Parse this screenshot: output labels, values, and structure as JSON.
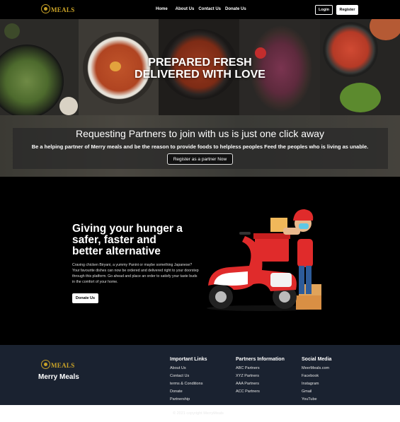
{
  "nav": {
    "logo_text": "MEALS",
    "links": [
      "Home",
      "About Us",
      "Contact Us",
      "Donate Us"
    ],
    "login_label": "Login",
    "register_label": "Register"
  },
  "hero": {
    "title_line1": "PREPARED FRESH",
    "title_line2": "DELIVERED WITH LOVE",
    "partner_title": "Requesting Partners to join with us is just one click away",
    "partner_subtitle": "Be a helping partner of Merry meals and be the reason to provide foods to helpless peoples Feed the peoples who is living as unable.",
    "partner_button": "Register as a partner Now"
  },
  "delivery": {
    "title_line1": "Giving your hunger a",
    "title_line2": "safer, faster and",
    "title_line3": "better alternative",
    "description": "Craving chicken Biryani, a yummy Panini or maybe something Japanese? Your favourite dishes can now be ordered and delivered right to your doorstep through this platform. Go ahead and place an order to satisfy your taste buds in the comfort of your home.",
    "button_label": "Donate Us"
  },
  "footer": {
    "logo_text": "MEALS",
    "brand_name": "Merry Meals",
    "important_links": {
      "heading": "Important Links",
      "items": [
        "About Us",
        "Contact Us",
        "terms & Conditions",
        "Donate",
        "Partnership"
      ]
    },
    "partners_info": {
      "heading": "Partners Information",
      "items": [
        "ABC Partners",
        "XYZ Partners",
        "AAA Partners",
        "ACC Partners"
      ]
    },
    "social_media": {
      "heading": "Social Media",
      "items": [
        "MeerMeals.com",
        "Facebook",
        "Instagram",
        "Gmail",
        "YouTube"
      ]
    },
    "copyright": "© 2021 copyright MerryMeals"
  },
  "colors": {
    "brand_gold": "#c9a227",
    "footer_bg": "#1a2230",
    "scooter_red": "#e02b2b"
  }
}
